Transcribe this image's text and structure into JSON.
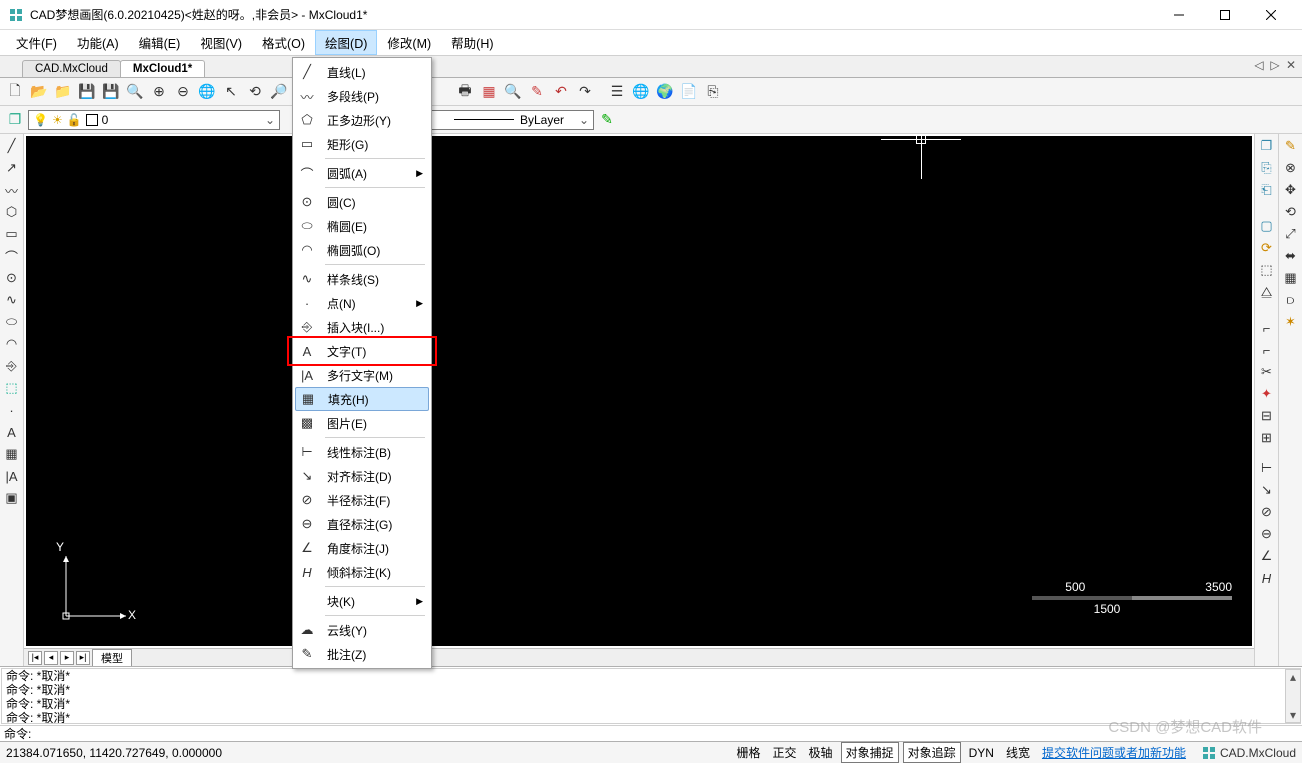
{
  "title": "CAD梦想画图(6.0.20210425)<姓赵的呀。,非会员> - MxCloud1*",
  "menu": {
    "file": "文件(F)",
    "func": "功能(A)",
    "edit": "编辑(E)",
    "view": "视图(V)",
    "format": "格式(O)",
    "draw": "绘图(D)",
    "modify": "修改(M)",
    "help": "帮助(H)"
  },
  "tabs": {
    "t1": "CAD.MxCloud",
    "t2": "MxCloud1*"
  },
  "layer": {
    "name": "0"
  },
  "linetype": "ByLayer",
  "drawmenu": {
    "line": "直线(L)",
    "pline": "多段线(P)",
    "polygon": "正多边形(Y)",
    "rect": "矩形(G)",
    "arc": "圆弧(A)",
    "circle": "圆(C)",
    "ellipse": "椭圆(E)",
    "elarc": "椭圆弧(O)",
    "spline": "样条线(S)",
    "point": "点(N)",
    "insert": "插入块(I...)",
    "text": "文字(T)",
    "mtext": "多行文字(M)",
    "hatch": "填充(H)",
    "image": "图片(E)",
    "dimlin": "线性标注(B)",
    "dimali": "对齐标注(D)",
    "dimrad": "半径标注(F)",
    "dimdia": "直径标注(G)",
    "dimang": "角度标注(J)",
    "dimobl": "倾斜标注(K)",
    "block": "块(K)",
    "cloud": "云线(Y)",
    "comment": "批注(Z)"
  },
  "modeltab": "模型",
  "cmd": {
    "l1": "命令:   *取消*",
    "l2": "命令:   *取消*",
    "l3": "命令:   *取消*",
    "l4": "命令:   *取消*",
    "prompt": "命令:"
  },
  "status": {
    "coords": "21384.071650,  11420.727649,  0.000000",
    "grid": "栅格",
    "ortho": "正交",
    "polar": "极轴",
    "osnap": "对象捕捉",
    "otrack": "对象追踪",
    "dyn": "DYN",
    "lwt": "线宽",
    "link": "提交软件问题或者加新功能",
    "brand": "CAD.MxCloud"
  },
  "ruler": {
    "a": "500",
    "b": "3500",
    "c": "1500"
  },
  "axes": {
    "y": "Y",
    "x": "X"
  },
  "watermark": "CSDN @梦想CAD软件"
}
